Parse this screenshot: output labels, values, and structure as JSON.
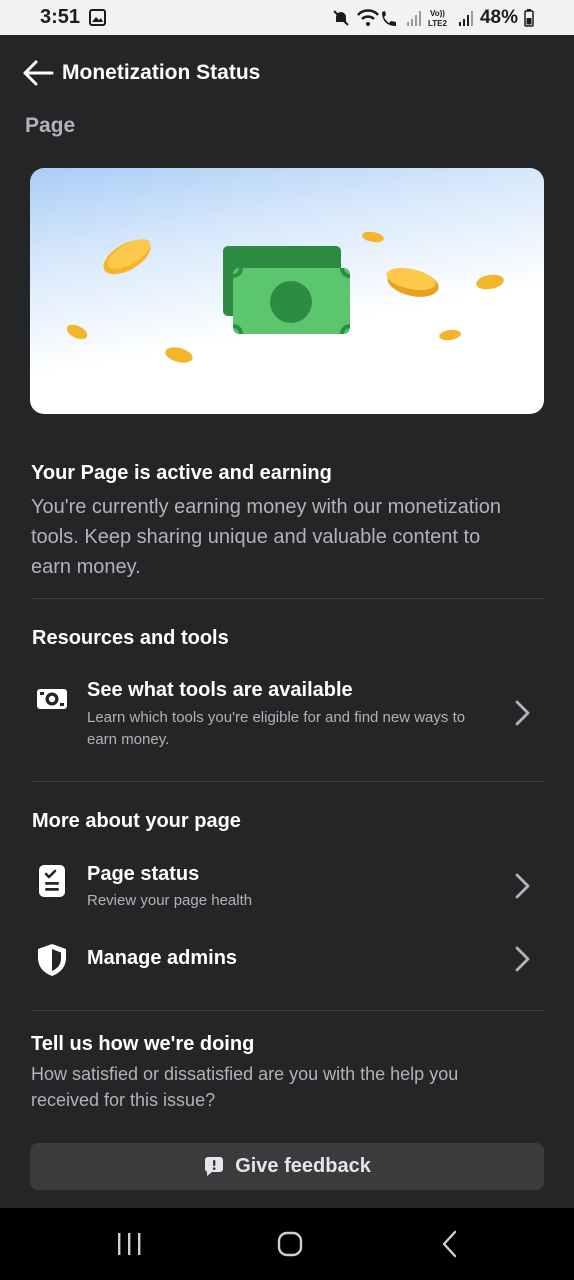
{
  "status_bar": {
    "time": "3:51",
    "battery": "48%",
    "icons": [
      "gallery-icon",
      "mute-icon",
      "wifi-calling-icon",
      "signal-icon",
      "volte-icon",
      "signal-icon",
      "battery-icon"
    ]
  },
  "header": {
    "title": "Monetization Status",
    "back_icon": "arrow-left-icon"
  },
  "section_label": "Page",
  "status": {
    "title": "Your Page is active and earning",
    "description": "You're currently earning money with our monetization tools. Keep sharing unique and valuable content to earn money."
  },
  "resources": {
    "title": "Resources and tools",
    "items": [
      {
        "icon": "money-icon",
        "title": "See what tools are available",
        "subtitle": "Learn which tools you're eligible for and find new ways to earn money."
      }
    ]
  },
  "more": {
    "title": "More about your page",
    "items": [
      {
        "icon": "checklist-icon",
        "title": "Page status",
        "subtitle": "Review your page health"
      },
      {
        "icon": "shield-icon",
        "title": "Manage admins",
        "subtitle": ""
      }
    ]
  },
  "feedback": {
    "title": "Tell us how we're doing",
    "description": "How satisfied or dissatisfied are you with the help you received for this issue?",
    "button_label": "Give feedback"
  },
  "nav_bar": {
    "buttons": [
      "recent-apps-icon",
      "home-icon",
      "back-icon"
    ]
  },
  "colors": {
    "background": "#242526",
    "text_primary": "#ffffff",
    "text_secondary": "#b0b3b8",
    "button_bg": "#3a3b3c",
    "money_green": "#42b35c",
    "coin_gold": "#f5b52a"
  }
}
